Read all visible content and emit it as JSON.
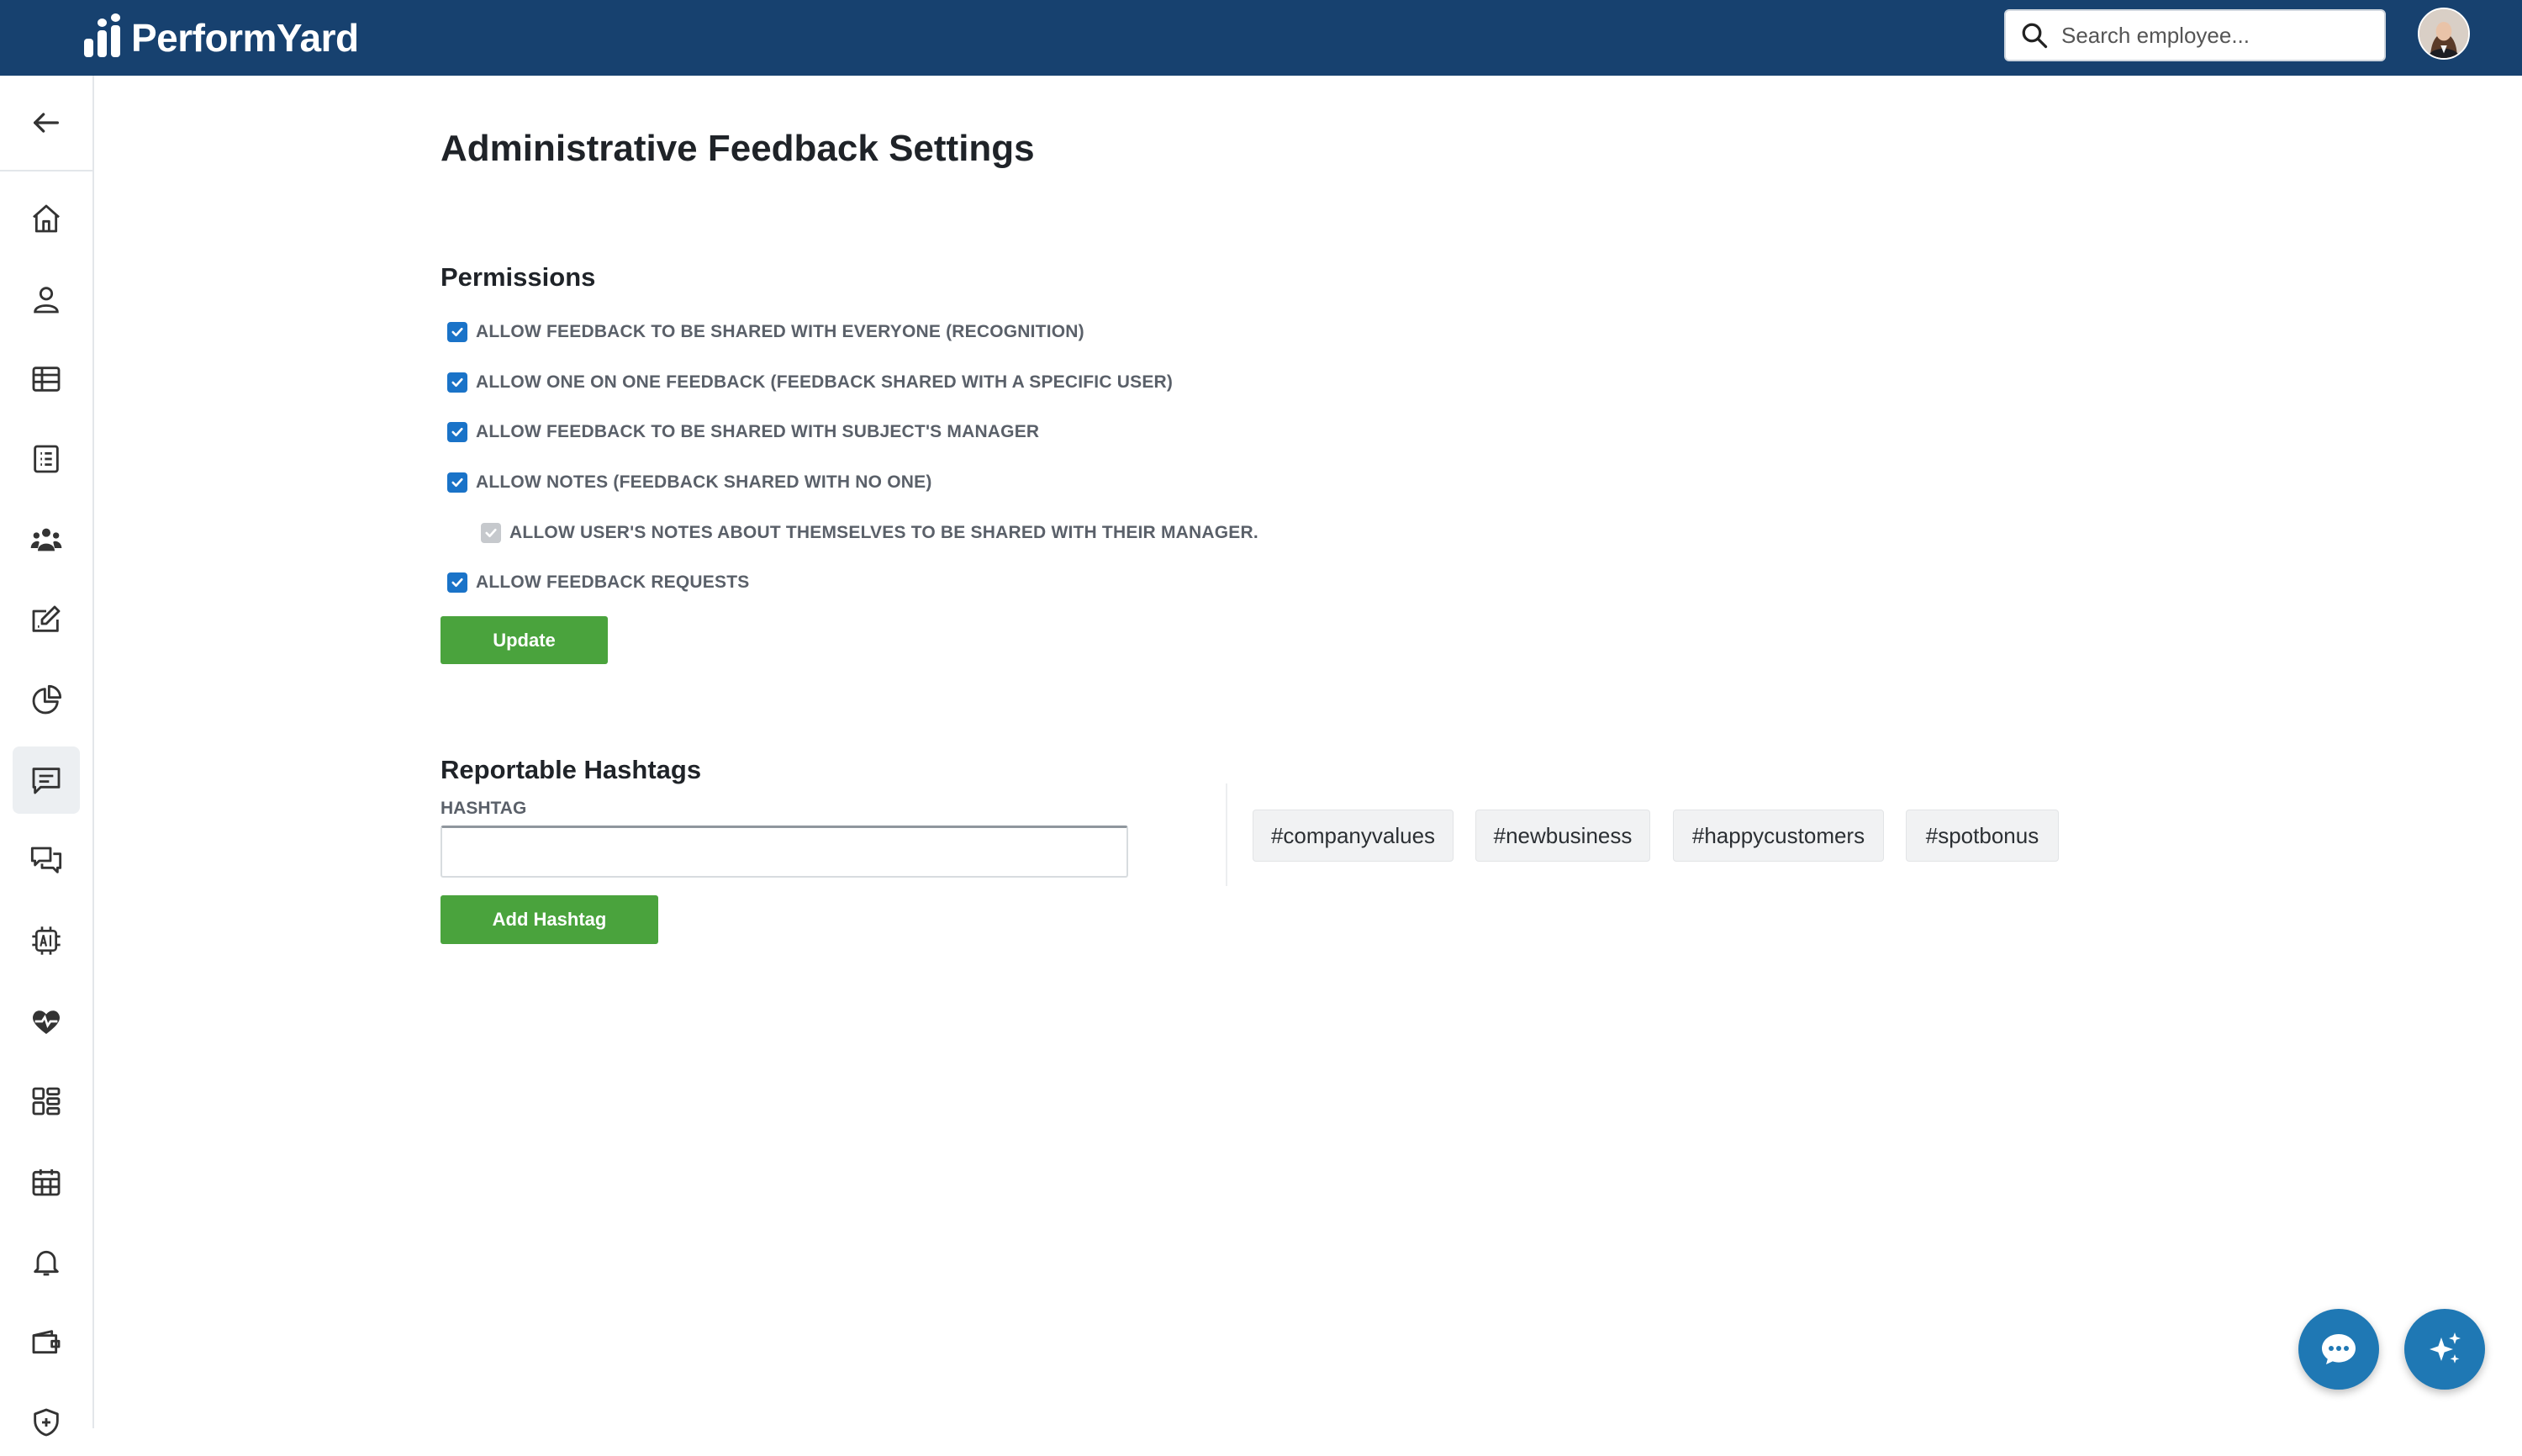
{
  "brand": {
    "name": "PerformYard"
  },
  "header": {
    "search_placeholder": "Search employee..."
  },
  "page": {
    "title": "Administrative Feedback Settings"
  },
  "permissions": {
    "title": "Permissions",
    "options": [
      {
        "label": "Allow feedback to be shared with everyone (recognition)",
        "checked": true,
        "disabled": false
      },
      {
        "label": "Allow one on one feedback (feedback shared with a specific user)",
        "checked": true,
        "disabled": false
      },
      {
        "label": "Allow feedback to be shared with subject's manager",
        "checked": true,
        "disabled": false
      },
      {
        "label": "Allow notes (feedback shared with no one)",
        "checked": true,
        "disabled": false
      },
      {
        "label": "Allow user's notes about themselves to be shared with their manager.",
        "checked": true,
        "disabled": true
      },
      {
        "label": "Allow feedback requests",
        "checked": true,
        "disabled": false
      }
    ],
    "update_label": "Update"
  },
  "hashtags": {
    "title": "Reportable Hashtags",
    "field_label": "HASHTAG",
    "input_value": "",
    "add_label": "Add Hashtag",
    "tags": [
      "#companyvalues",
      "#newbusiness",
      "#happycustomers",
      "#spotbonus"
    ]
  },
  "sidebar": {
    "icons": [
      "home-icon",
      "person-icon",
      "table-icon",
      "checklist-icon",
      "team-icon",
      "edit-icon",
      "pie-chart-icon",
      "feedback-icon",
      "chat-icon",
      "ai-chip-icon",
      "heartbeat-icon",
      "dashboard-icon",
      "calendar-icon",
      "bell-icon",
      "wallet-icon",
      "shield-icon"
    ],
    "active": "feedback-icon"
  },
  "colors": {
    "topbar": "#17416f",
    "accent_green": "#4aa33d",
    "checkbox_blue": "#1a73c8",
    "fab_blue": "#1f78b4"
  }
}
